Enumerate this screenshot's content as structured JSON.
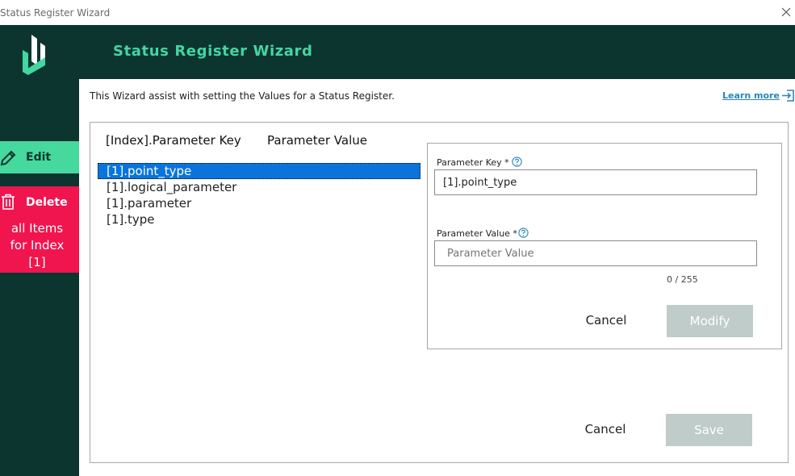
{
  "window": {
    "title": "Status Register Wizard"
  },
  "header": {
    "title": "Status Register Wizard"
  },
  "sidebar": {
    "edit_label": "Edit",
    "delete_label": "Delete",
    "delete_sub": "all Items\nfor Index\n[1]"
  },
  "intro": {
    "text": "This Wizard assist with setting the Values for a Status Register.",
    "learn_more": "Learn more"
  },
  "columns": {
    "key": "[Index].Parameter Key",
    "value": "Parameter Value"
  },
  "list": {
    "items": [
      "[1].point_type",
      "[1].logical_parameter",
      "[1].parameter",
      "[1].type"
    ],
    "selected_index": 0
  },
  "editor": {
    "key_label": "Parameter Key *",
    "key_value": "[1].point_type",
    "value_label": "Parameter Value *",
    "value_placeholder": "Parameter Value",
    "counter": "0 / 255",
    "cancel": "Cancel",
    "modify": "Modify"
  },
  "footer": {
    "cancel": "Cancel",
    "save": "Save"
  },
  "colors": {
    "header_bg": "#0d3530",
    "accent_green": "#43d6a0",
    "edit_bg": "#46d99e",
    "delete_bg": "#f0144f",
    "selection_blue": "#0a74dc",
    "link_blue": "#2a86b7",
    "disabled_btn": "#bfccca"
  }
}
